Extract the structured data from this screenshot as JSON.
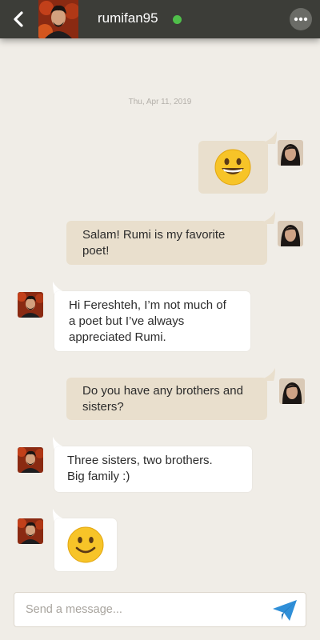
{
  "colors": {
    "header_bg": "#3c3d38",
    "online": "#4fbf4a",
    "outgoing_bubble": "#e9dfcd",
    "incoming_bubble": "#ffffff",
    "send_icon": "#2f8fd8"
  },
  "header": {
    "username": "rumifan95",
    "status": "online",
    "back_icon": "chevron-left-icon",
    "more_icon": "more-dots-icon"
  },
  "conversation": {
    "date": "Thu, Apr 11, 2019",
    "messages": [
      {
        "direction": "outgoing",
        "type": "emoji",
        "emoji": "grinning-face"
      },
      {
        "direction": "outgoing",
        "type": "text",
        "lines": [
          "Salam!  Rumi is my favorite",
          "poet!"
        ]
      },
      {
        "direction": "incoming",
        "type": "text",
        "lines": [
          "Hi Fereshteh, I’m not much of",
          "a poet but I’ve always",
          "appreciated Rumi."
        ]
      },
      {
        "direction": "outgoing",
        "type": "text",
        "lines": [
          "Do you have any brothers and",
          "sisters?"
        ]
      },
      {
        "direction": "incoming",
        "type": "text",
        "lines": [
          "Three sisters, two brothers.",
          "Big family :)"
        ]
      },
      {
        "direction": "incoming",
        "type": "emoji",
        "emoji": "slightly-smiling-face"
      }
    ]
  },
  "composer": {
    "placeholder": "Send a message...",
    "value": "",
    "send_icon": "paper-plane-icon"
  }
}
